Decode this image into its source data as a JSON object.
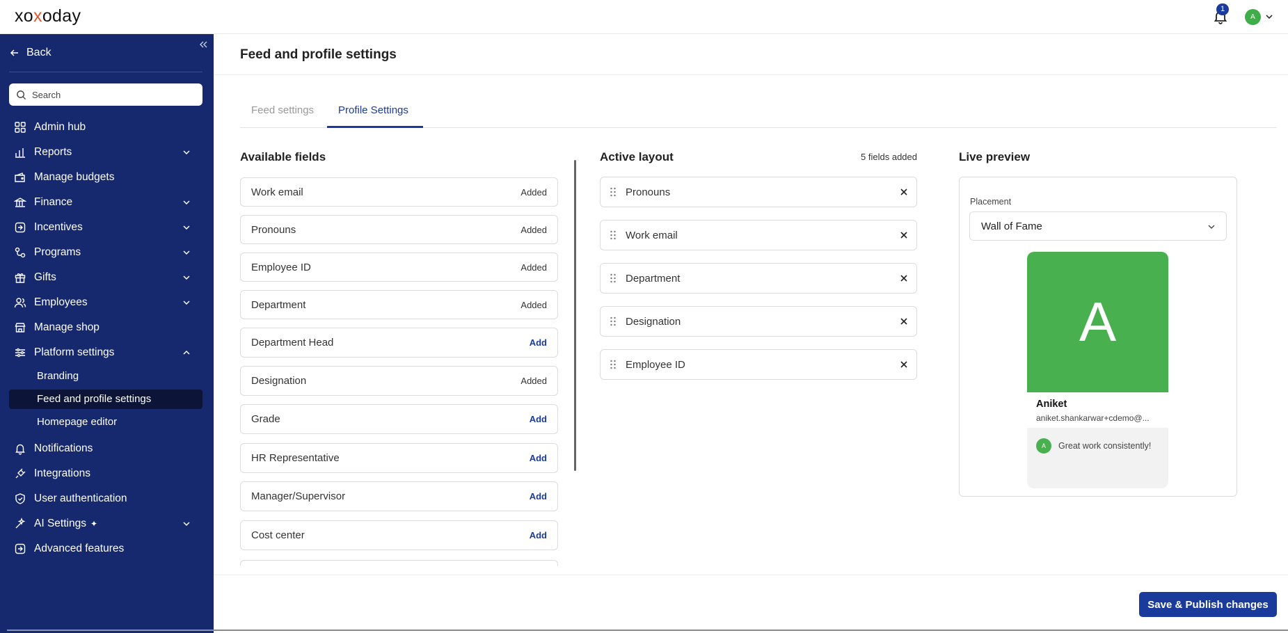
{
  "brand": {
    "logo_pre": "xo",
    "logo_o": "x",
    "logo_post": "oday"
  },
  "header": {
    "notification_count": "1",
    "avatar_initial": "A"
  },
  "sidebar": {
    "back_label": "Back",
    "search_placeholder": "Search",
    "items": [
      {
        "label": "Admin hub",
        "icon": "grid-icon"
      },
      {
        "label": "Reports",
        "icon": "bar-chart-icon",
        "expandable": true
      },
      {
        "label": "Manage budgets",
        "icon": "wallet-icon"
      },
      {
        "label": "Finance",
        "icon": "bank-icon",
        "expandable": true
      },
      {
        "label": "Incentives",
        "icon": "incentive-icon",
        "expandable": true
      },
      {
        "label": "Programs",
        "icon": "programs-icon",
        "expandable": true
      },
      {
        "label": "Gifts",
        "icon": "gift-icon",
        "expandable": true
      },
      {
        "label": "Employees",
        "icon": "users-icon",
        "expandable": true
      },
      {
        "label": "Manage shop",
        "icon": "shop-icon"
      },
      {
        "label": "Platform settings",
        "icon": "sliders-icon",
        "expanded": true
      },
      {
        "label": "Notifications",
        "icon": "bell-icon"
      },
      {
        "label": "Integrations",
        "icon": "plug-icon"
      },
      {
        "label": "User authentication",
        "icon": "shield-icon"
      },
      {
        "label": "AI Settings",
        "icon": "ai-icon",
        "expandable": true
      },
      {
        "label": "Advanced features",
        "icon": "advanced-icon"
      }
    ],
    "sub_items": [
      "Branding",
      "Feed and profile settings",
      "Homepage editor"
    ],
    "active_sub": "Feed and profile settings"
  },
  "page": {
    "title": "Feed and profile settings",
    "tabs": [
      {
        "label": "Feed settings",
        "active": false
      },
      {
        "label": "Profile Settings",
        "active": true
      }
    ]
  },
  "available": {
    "title": "Available fields",
    "fields": [
      {
        "name": "Work email",
        "status": "Added"
      },
      {
        "name": "Pronouns",
        "status": "Added"
      },
      {
        "name": "Employee ID",
        "status": "Added"
      },
      {
        "name": "Department",
        "status": "Added"
      },
      {
        "name": "Department Head",
        "status": "Add"
      },
      {
        "name": "Designation",
        "status": "Added"
      },
      {
        "name": "Grade",
        "status": "Add"
      },
      {
        "name": "HR Representative",
        "status": "Add"
      },
      {
        "name": "Manager/Supervisor",
        "status": "Add"
      },
      {
        "name": "Cost center",
        "status": "Add"
      }
    ]
  },
  "active_layout": {
    "title": "Active layout",
    "count_text": "5 fields added",
    "fields": [
      "Pronouns",
      "Work email",
      "Department",
      "Designation",
      "Employee ID"
    ]
  },
  "preview": {
    "title": "Live preview",
    "placement_label": "Placement",
    "placement_value": "Wall of Fame",
    "card": {
      "initial": "A",
      "name": "Aniket",
      "email": "aniket.shankarwar+cdemo@...",
      "message_initial": "A",
      "message": "Great work consistently!"
    }
  },
  "footer": {
    "save_label": "Save & Publish changes"
  },
  "colors": {
    "primary": "#1a3a9c",
    "sidebar": "#16296f",
    "avatar_green": "#48b04e"
  }
}
